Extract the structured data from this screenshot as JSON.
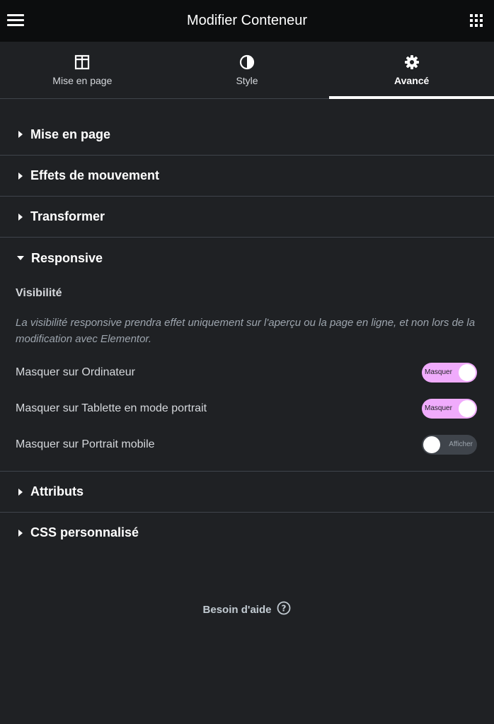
{
  "header": {
    "title": "Modifier Conteneur",
    "menu_icon": "hamburger-menu-icon",
    "apps_icon": "grid-apps-icon"
  },
  "tabs": [
    {
      "label": "Mise en page",
      "icon": "layout-columns-icon",
      "active": false
    },
    {
      "label": "Style",
      "icon": "half-circle-contrast-icon",
      "active": false
    },
    {
      "label": "Avancé",
      "icon": "gear-icon",
      "active": true
    }
  ],
  "sections": {
    "mise_en_page": "Mise en page",
    "effets": "Effets de mouvement",
    "transformer": "Transformer",
    "responsive": "Responsive",
    "attributs": "Attributs",
    "css": "CSS personnalisé"
  },
  "responsive": {
    "visibility_title": "Visibilité",
    "description": "La visibilité responsive prendra effet uniquement sur l'aperçu ou la page en ligne, et non lors de la modification avec Elementor.",
    "rows": [
      {
        "label": "Masquer sur Ordinateur",
        "state": "on",
        "toggle_text": "Masquer"
      },
      {
        "label": "Masquer sur Tablette en mode portrait",
        "state": "on",
        "toggle_text": "Masquer"
      },
      {
        "label": "Masquer sur Portrait mobile",
        "state": "off",
        "toggle_text": "Afficher"
      }
    ]
  },
  "help": {
    "label": "Besoin d'aide",
    "icon": "question-circle-icon"
  },
  "colors": {
    "toggle_on": "#f0abfc",
    "toggle_off": "#3f444b",
    "background": "#1f2124",
    "header": "#0c0d0e"
  }
}
